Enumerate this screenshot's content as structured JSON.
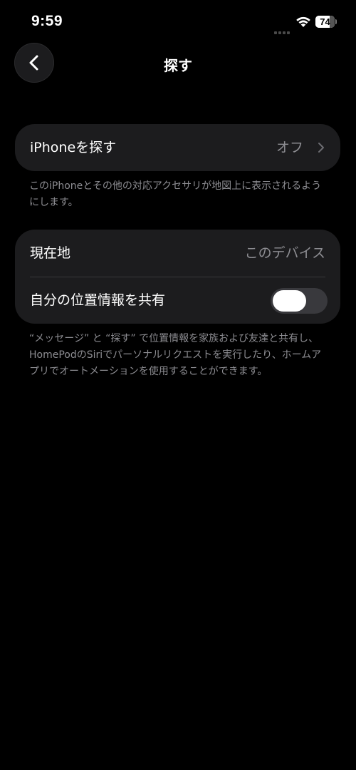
{
  "status_bar": {
    "time": "9:59",
    "battery_level": "74",
    "battery_fraction": 0.74
  },
  "nav": {
    "title": "探す"
  },
  "find_iphone_section": {
    "label": "iPhoneを探す",
    "value": "オフ",
    "footnote": "このiPhoneとその他の対応アクセサリが地図上に表示されるようにします。"
  },
  "location_section": {
    "current_location_label": "現在地",
    "current_location_value": "このデバイス",
    "share_location_label": "自分の位置情報を共有",
    "share_location_enabled": false,
    "footnote": "“メッセージ” と “探す” で位置情報を家族および友達と共有し、HomePodのSiriでパーソナルリクエストを実行したり、ホームアプリでオートメーションを使用することができます。"
  },
  "colors": {
    "background": "#000000",
    "group_background": "#1c1c1e",
    "secondary_text": "#8d8d92",
    "toggle_off": "#39393d"
  }
}
